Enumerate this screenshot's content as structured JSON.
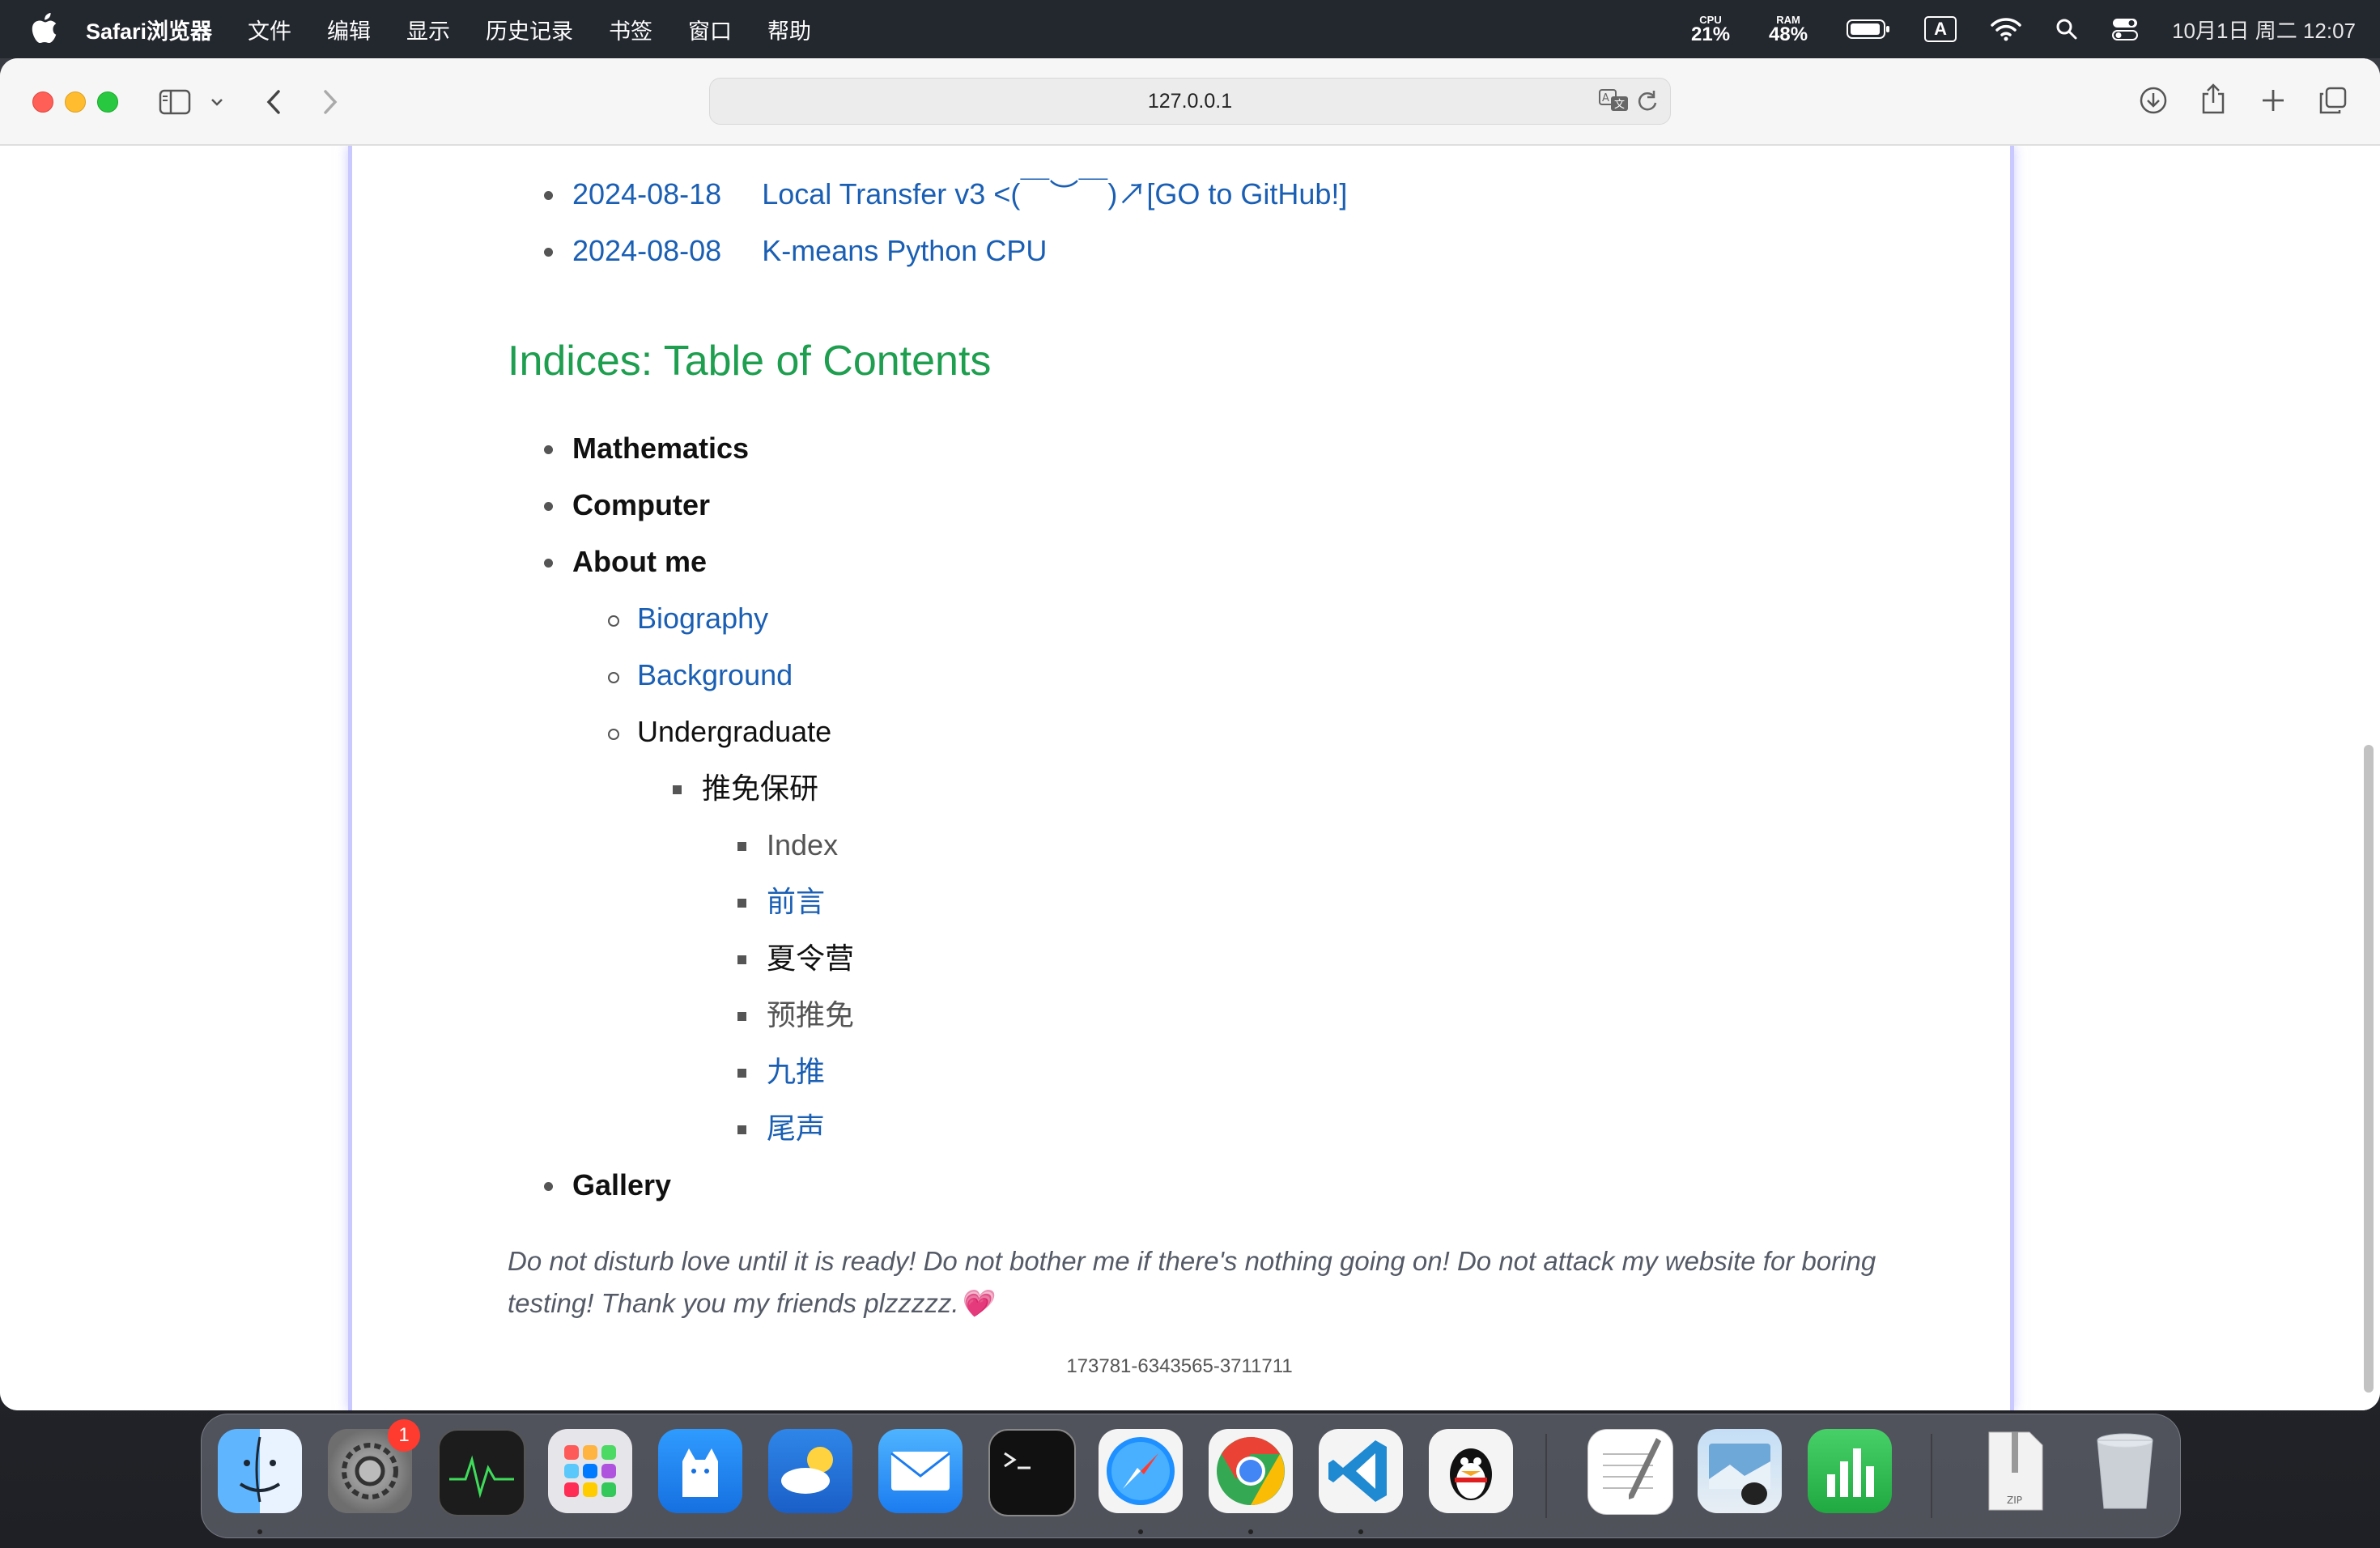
{
  "menubar": {
    "app_name": "Safari浏览器",
    "menus": [
      "文件",
      "编辑",
      "显示",
      "历史记录",
      "书签",
      "窗口",
      "帮助"
    ],
    "cpu_label": "CPU",
    "cpu_value": "21%",
    "ram_label": "RAM",
    "ram_value": "48%",
    "input_method": "A",
    "clock": "10月1日 周二  12:07"
  },
  "browser": {
    "url": "127.0.0.1"
  },
  "page": {
    "recent": [
      {
        "date": "2024-08-18",
        "title": "Local Transfer v3 <(￣︶￣)↗[GO to GitHub!]"
      },
      {
        "date": "2024-08-08",
        "title": "K-means Python CPU"
      }
    ],
    "toc_heading": "Indices: Table of Contents",
    "toc": {
      "mathematics": "Mathematics",
      "computer": "Computer",
      "about_me": "About me",
      "biography": "Biography",
      "background": "Background",
      "undergraduate": "Undergraduate",
      "recommend": "推免保研",
      "index": "Index",
      "preface": "前言",
      "summer_camp": "夏令营",
      "pre_recommend": "预推免",
      "september": "九推",
      "epilogue": "尾声",
      "gallery": "Gallery"
    },
    "quote": "Do not disturb love until it is ready! Do not bother me if there's nothing going on! Do not attack my website for boring testing! Thank you my friends plzzzzz.💗",
    "footer_code": "173781-6343565-3711711"
  },
  "dock": {
    "settings_badge": "1",
    "apps": [
      "finder-icon",
      "system-settings-icon",
      "activity-monitor-icon",
      "launchpad-icon",
      "stats-cat-icon",
      "weather-icon",
      "mail-icon",
      "terminal-icon",
      "safari-icon",
      "chrome-icon",
      "vscode-icon",
      "qq-icon",
      "textedit-icon",
      "preview-icon",
      "numbers-icon",
      "zip-archive-icon",
      "trash-icon"
    ],
    "zip_label": "ZIP"
  },
  "colors": {
    "link": "#1a5fb4",
    "heading": "#1e9e4f",
    "article_border": "#c9c9ff"
  }
}
